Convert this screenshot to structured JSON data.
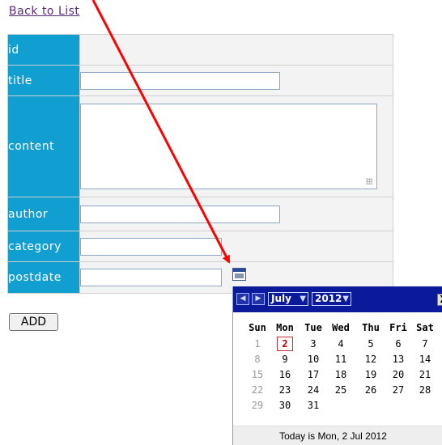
{
  "nav": {
    "back_link": "Back to List"
  },
  "form": {
    "rows": [
      {
        "label": "id"
      },
      {
        "label": "title",
        "value": ""
      },
      {
        "label": "content",
        "value": ""
      },
      {
        "label": "author",
        "value": ""
      },
      {
        "label": "category",
        "value": ""
      },
      {
        "label": "postdate",
        "value": ""
      }
    ],
    "submit_label": "ADD"
  },
  "calendar": {
    "month": "July",
    "year": "2012",
    "prev_icon": "left-arrow-icon",
    "next_icon": "right-arrow-icon",
    "close_label": "X",
    "days_of_week": [
      "Sun",
      "Mon",
      "Tue",
      "Wed",
      "Thu",
      "Fri",
      "Sat"
    ],
    "weeks": [
      [
        "1",
        "2",
        "3",
        "4",
        "5",
        "6",
        "7"
      ],
      [
        "8",
        "9",
        "10",
        "11",
        "12",
        "13",
        "14"
      ],
      [
        "15",
        "16",
        "17",
        "18",
        "19",
        "20",
        "21"
      ],
      [
        "22",
        "23",
        "24",
        "25",
        "26",
        "27",
        "28"
      ],
      [
        "29",
        "30",
        "31"
      ]
    ],
    "today_day": "2",
    "footer": "Today is Mon, 2 Jul 2012"
  },
  "colors": {
    "label_bg": "#109fd0",
    "calendar_header": "#0a1a9a",
    "annotation_arrow": "#ff0000"
  }
}
